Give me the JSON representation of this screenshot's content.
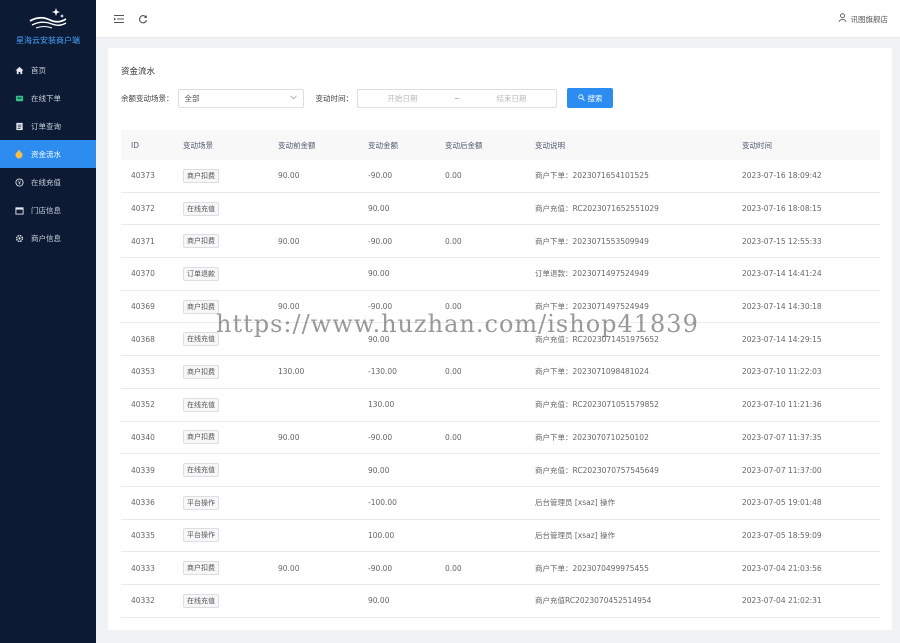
{
  "app": {
    "name": "星海云安装商户端"
  },
  "sidebar": {
    "items": [
      {
        "label": "首页",
        "icon": "home-icon",
        "active": false
      },
      {
        "label": "在线下单",
        "icon": "order-icon",
        "active": false
      },
      {
        "label": "订单查询",
        "icon": "list-icon",
        "active": false
      },
      {
        "label": "资金流水",
        "icon": "money-bag-icon",
        "active": true
      },
      {
        "label": "在线充值",
        "icon": "recharge-icon",
        "active": false
      },
      {
        "label": "门店信息",
        "icon": "store-icon",
        "active": false
      },
      {
        "label": "商户信息",
        "icon": "gear-icon",
        "active": false
      }
    ]
  },
  "header": {
    "user": "讯图旗舰店"
  },
  "page": {
    "title": "资金流水",
    "filters": {
      "scene_label": "余额变动场景：",
      "scene_value": "全部",
      "time_label": "变动时间：",
      "start_placeholder": "开始日期",
      "end_placeholder": "结束日期",
      "search_label": "搜索"
    }
  },
  "table": {
    "columns": [
      "ID",
      "变动场景",
      "变动前金额",
      "变动金额",
      "变动后金额",
      "变动说明",
      "变动时间"
    ],
    "rows": [
      {
        "id": "40373",
        "scene": "商户扣费",
        "before": "90.00",
        "amount": "-90.00",
        "after": "0.00",
        "desc": "商户下单：2023071654101525",
        "time": "2023-07-16 18:09:42"
      },
      {
        "id": "40372",
        "scene": "在线充值",
        "before": "",
        "amount": "90.00",
        "after": "",
        "desc": "商户充值：RC2023071652551029",
        "time": "2023-07-16 18:08:15"
      },
      {
        "id": "40371",
        "scene": "商户扣费",
        "before": "90.00",
        "amount": "-90.00",
        "after": "0.00",
        "desc": "商户下单：2023071553509949",
        "time": "2023-07-15 12:55:33"
      },
      {
        "id": "40370",
        "scene": "订单退款",
        "before": "",
        "amount": "90.00",
        "after": "",
        "desc": "订单退款：2023071497524949",
        "time": "2023-07-14 14:41:24"
      },
      {
        "id": "40369",
        "scene": "商户扣费",
        "before": "90.00",
        "amount": "-90.00",
        "after": "0.00",
        "desc": "商户下单：2023071497524949",
        "time": "2023-07-14 14:30:18"
      },
      {
        "id": "40368",
        "scene": "在线充值",
        "before": "",
        "amount": "90.00",
        "after": "",
        "desc": "商户充值：RC2023071451975652",
        "time": "2023-07-14 14:29:15"
      },
      {
        "id": "40353",
        "scene": "商户扣费",
        "before": "130.00",
        "amount": "-130.00",
        "after": "0.00",
        "desc": "商户下单：2023071098481024",
        "time": "2023-07-10 11:22:03"
      },
      {
        "id": "40352",
        "scene": "在线充值",
        "before": "",
        "amount": "130.00",
        "after": "",
        "desc": "商户充值：RC2023071051579852",
        "time": "2023-07-10 11:21:36"
      },
      {
        "id": "40340",
        "scene": "商户扣费",
        "before": "90.00",
        "amount": "-90.00",
        "after": "0.00",
        "desc": "商户下单：2023070710250102",
        "time": "2023-07-07 11:37:35"
      },
      {
        "id": "40339",
        "scene": "在线充值",
        "before": "",
        "amount": "90.00",
        "after": "",
        "desc": "商户充值：RC2023070757545649",
        "time": "2023-07-07 11:37:00"
      },
      {
        "id": "40336",
        "scene": "平台操作",
        "before": "",
        "amount": "-100.00",
        "after": "",
        "desc": "后台管理员 [xsaz] 操作",
        "time": "2023-07-05 19:01:48"
      },
      {
        "id": "40335",
        "scene": "平台操作",
        "before": "",
        "amount": "100.00",
        "after": "",
        "desc": "后台管理员 [xsaz] 操作",
        "time": "2023-07-05 18:59:09"
      },
      {
        "id": "40333",
        "scene": "商户扣费",
        "before": "90.00",
        "amount": "-90.00",
        "after": "0.00",
        "desc": "商户下单：2023070499975455",
        "time": "2023-07-04 21:03:56"
      },
      {
        "id": "40332",
        "scene": "在线充值",
        "before": "",
        "amount": "90.00",
        "after": "",
        "desc": "商户充值RC2023070452514954",
        "time": "2023-07-04 21:02:31"
      }
    ]
  },
  "watermark": "https://www.huzhan.com/ishop41839",
  "colors": {
    "sidebar_bg": "#0c1a33",
    "primary": "#2d8cf0",
    "logo_text": "#4aa3ff"
  }
}
